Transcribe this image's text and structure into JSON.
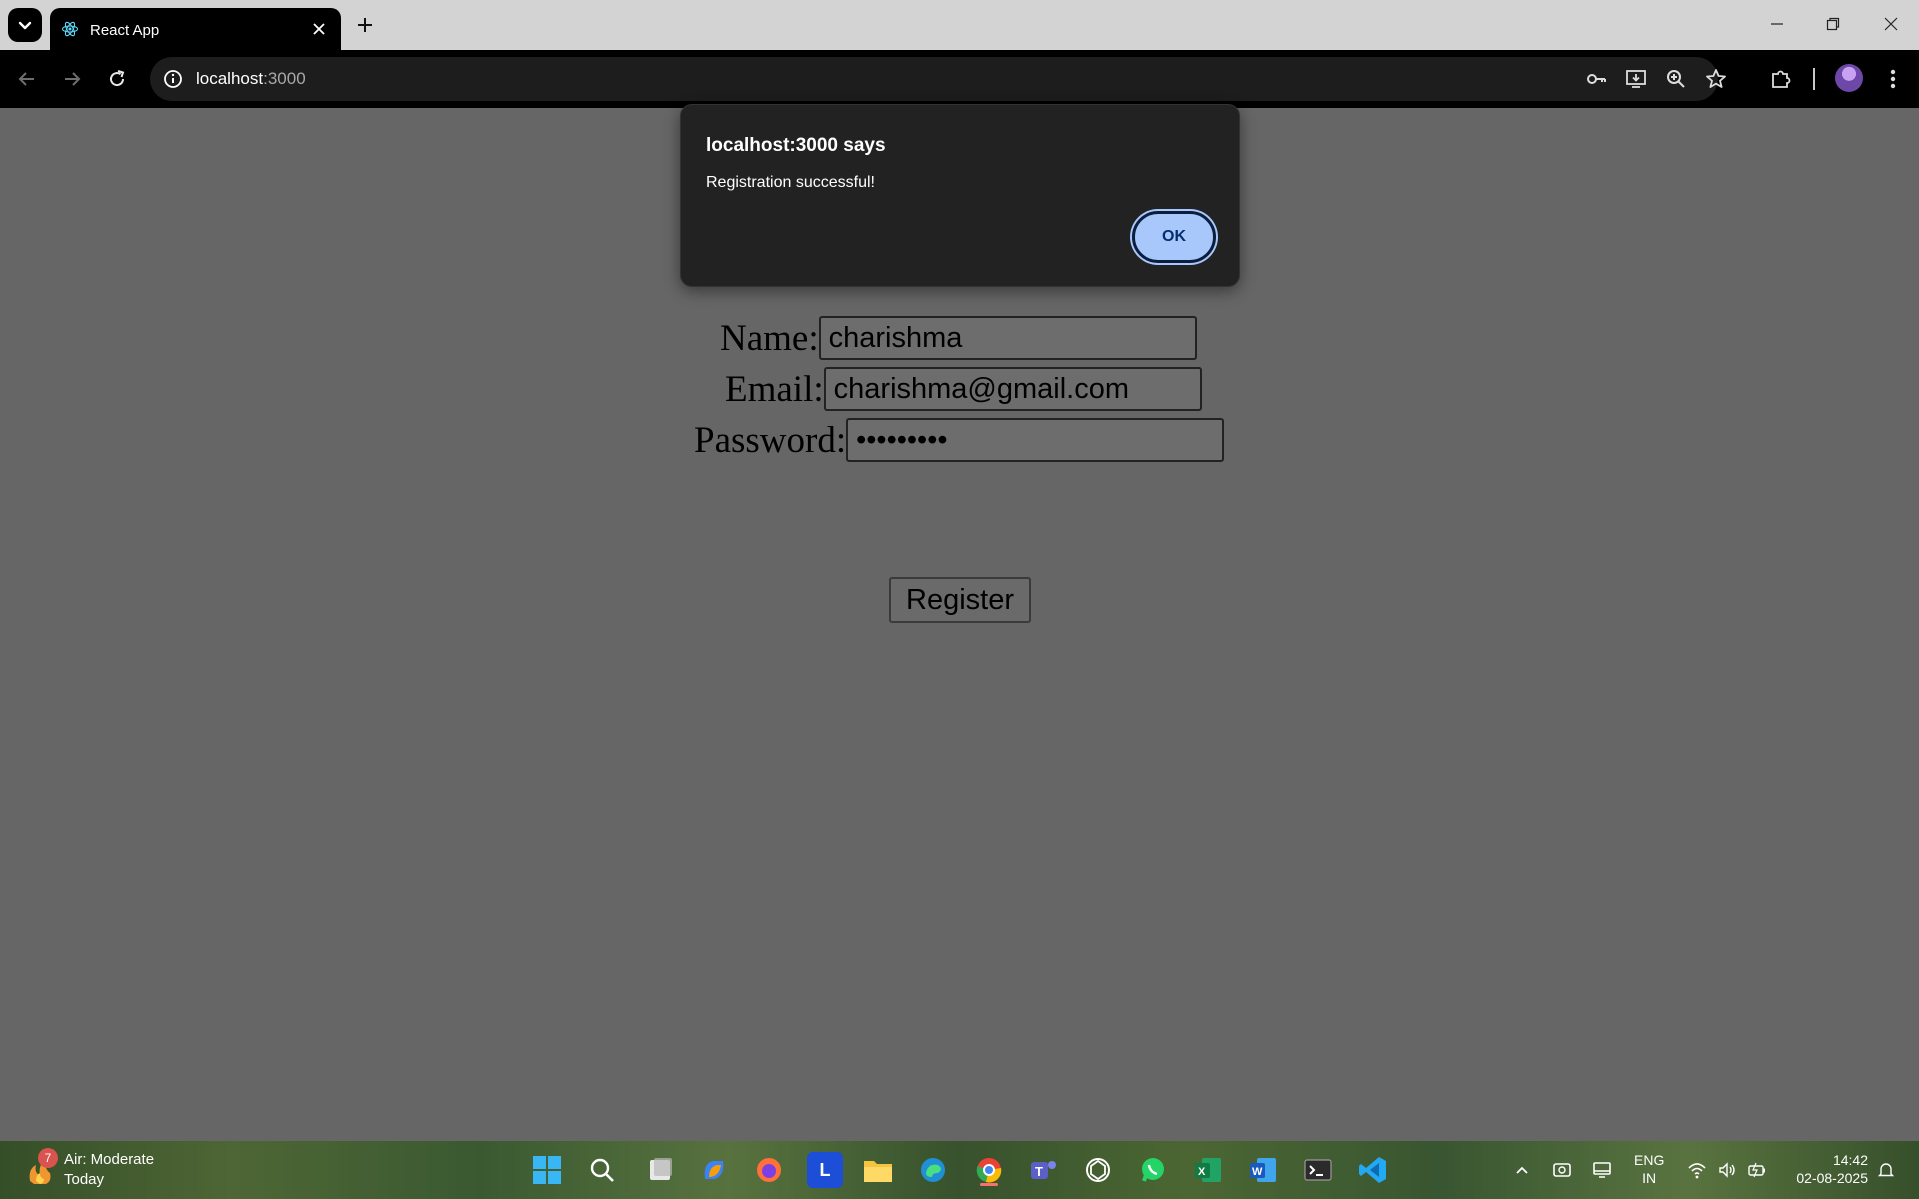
{
  "browser": {
    "tab": {
      "title": "React App"
    },
    "address": {
      "host": "localhost",
      "port": ":3000"
    }
  },
  "form": {
    "name_label": "Name:",
    "name_value": "charishma",
    "email_label": "Email:",
    "email_value": "charishma@gmail.com",
    "password_label": "Password:",
    "password_mask": "•••••••••",
    "register_label": "Register"
  },
  "dialog": {
    "title": "localhost:3000 says",
    "message": "Registration successful!",
    "ok_label": "OK"
  },
  "taskbar": {
    "weather_badge": "7",
    "weather_line1": "Air: Moderate",
    "weather_line2": "Today",
    "lang_line1": "ENG",
    "lang_line2": "IN",
    "time": "14:42",
    "date": "02-08-2025",
    "apps": [
      "start-icon",
      "search-icon",
      "task-view-icon",
      "copilot-icon",
      "firefox-icon",
      "l-app-icon",
      "file-explorer-icon",
      "edge-icon",
      "chrome-icon",
      "teams-icon",
      "chatgpt-icon",
      "whatsapp-icon",
      "excel-icon",
      "word-icon",
      "terminal-icon",
      "vscode-icon"
    ]
  },
  "colors": {
    "page_bg": "#666666",
    "dialog_bg": "#222222",
    "ok_button": "#a8c7fa",
    "toolbar_bg": "#000000",
    "tabstrip_bg": "#d3d3d3"
  }
}
